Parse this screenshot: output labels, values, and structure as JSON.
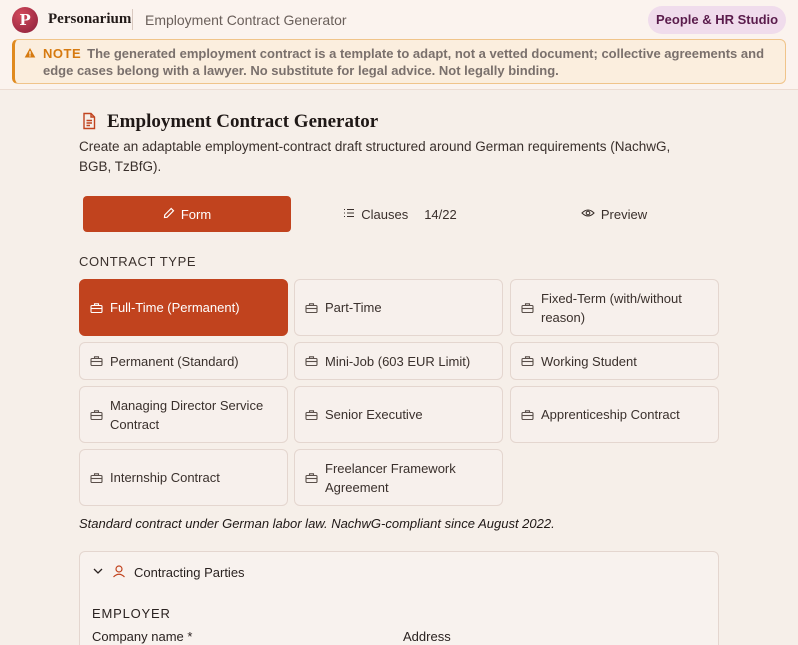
{
  "header": {
    "logo_letter": "P",
    "brand": "Personarium",
    "app_title": "Employment Contract Generator",
    "studio_badge": "People & HR Studio"
  },
  "note": {
    "label": "NOTE",
    "text": "The generated employment contract is a template to adapt, not a vetted document; collective agreements and edge cases belong with a lawyer. No substitute for legal advice. Not legally binding."
  },
  "page": {
    "title": "Employment Contract Generator",
    "description": "Create an adaptable employment-contract draft structured around German requirements (NachwG, BGB, TzBfG)."
  },
  "tabs": [
    {
      "label": "Form",
      "icon": "pencil-icon",
      "active": true
    },
    {
      "label": "Clauses",
      "icon": "list-icon",
      "count": "14/22"
    },
    {
      "label": "Preview",
      "icon": "eye-icon"
    }
  ],
  "contract_type": {
    "label": "CONTRACT TYPE",
    "icon": "briefcase-icon",
    "options": [
      "Full-Time (Permanent)",
      "Part-Time",
      "Fixed-Term (with/without reason)",
      "Permanent (Standard)",
      "Mini-Job (603 EUR Limit)",
      "Working Student",
      "Managing Director Service Contract",
      "Senior Executive",
      "Apprenticeship Contract",
      "Internship Contract",
      "Freelancer Framework Agreement"
    ],
    "selected": "Full-Time (Permanent)",
    "description": "Standard contract under German labor law. NachwG-compliant since August 2022."
  },
  "parties": {
    "title": "Contracting Parties",
    "employer_label": "EMPLOYER",
    "company_name_label": "Company name *",
    "address_label": "Address"
  },
  "colors": {
    "accent": "#c1431e",
    "note_accent": "#e08a1e",
    "badge_bg": "#f0dcec",
    "badge_text": "#5a1c4c"
  }
}
